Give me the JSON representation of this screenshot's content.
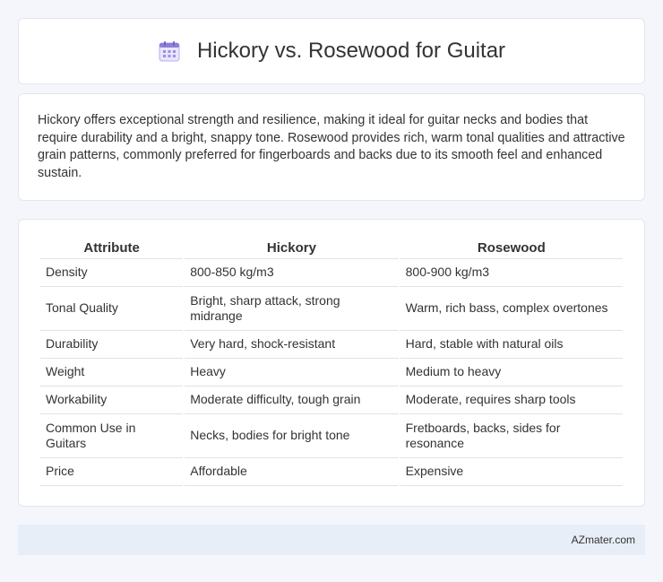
{
  "header": {
    "title": "Hickory vs. Rosewood for Guitar",
    "icon": "calendar-icon"
  },
  "intro": {
    "text": "Hickory offers exceptional strength and resilience, making it ideal for guitar necks and bodies that require durability and a bright, snappy tone. Rosewood provides rich, warm tonal qualities and attractive grain patterns, commonly preferred for fingerboards and backs due to its smooth feel and enhanced sustain."
  },
  "table": {
    "headers": [
      "Attribute",
      "Hickory",
      "Rosewood"
    ],
    "rows": [
      [
        "Density",
        "800-850 kg/m3",
        "800-900 kg/m3"
      ],
      [
        "Tonal Quality",
        "Bright, sharp attack, strong midrange",
        "Warm, rich bass, complex overtones"
      ],
      [
        "Durability",
        "Very hard, shock-resistant",
        "Hard, stable with natural oils"
      ],
      [
        "Weight",
        "Heavy",
        "Medium to heavy"
      ],
      [
        "Workability",
        "Moderate difficulty, tough grain",
        "Moderate, requires sharp tools"
      ],
      [
        "Common Use in Guitars",
        "Necks, bodies for bright tone",
        "Fretboards, backs, sides for resonance"
      ],
      [
        "Price",
        "Affordable",
        "Expensive"
      ]
    ]
  },
  "footer": {
    "text": "AZmater.com"
  },
  "colors": {
    "background": "#f4f6fb",
    "footer_bg": "#e8eef8",
    "icon_purple": "#8b7fd6"
  }
}
